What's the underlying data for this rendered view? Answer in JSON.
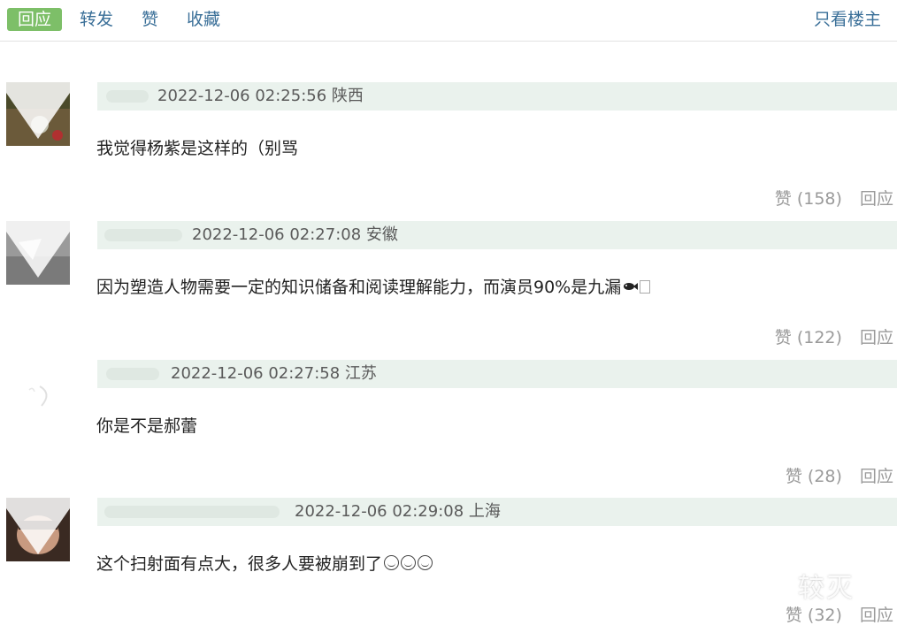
{
  "toolbar": {
    "reply_label": "回应",
    "forward_label": "转发",
    "like_label": "赞",
    "favorite_label": "收藏",
    "op_only_label": "只看楼主"
  },
  "comments": [
    {
      "timestamp": "2022-12-06 02:25:56",
      "location": "陕西",
      "text": "我觉得杨紫是这样的（别骂",
      "likes_label": "赞 (158)",
      "reply_label": "回应"
    },
    {
      "timestamp": "2022-12-06 02:27:08",
      "location": "安徽",
      "text": "因为塑造人物需要一定的知识储备和阅读理解能力，而演员90%是九漏",
      "likes_label": "赞 (122)",
      "reply_label": "回应"
    },
    {
      "timestamp": "2022-12-06 02:27:58",
      "location": "江苏",
      "text": "你是不是郝蕾",
      "likes_label": "赞 (28)",
      "reply_label": "回应"
    },
    {
      "timestamp": "2022-12-06 02:29:08",
      "location": "上海",
      "text": "这个扫射面有点大，很多人要被崩到了",
      "likes_label": "赞 (32)",
      "reply_label": "回应"
    }
  ],
  "watermark": "较灭",
  "icons": {
    "avatar": "avatar-image",
    "fish": "fish-emoji-icon",
    "grin": "grinning-emoji-icon"
  },
  "colors": {
    "accent_green": "#7dbf68",
    "link_blue": "#3a6f98",
    "meta_bar": "#eaf2ed",
    "action_gray": "#9a9a9a"
  }
}
